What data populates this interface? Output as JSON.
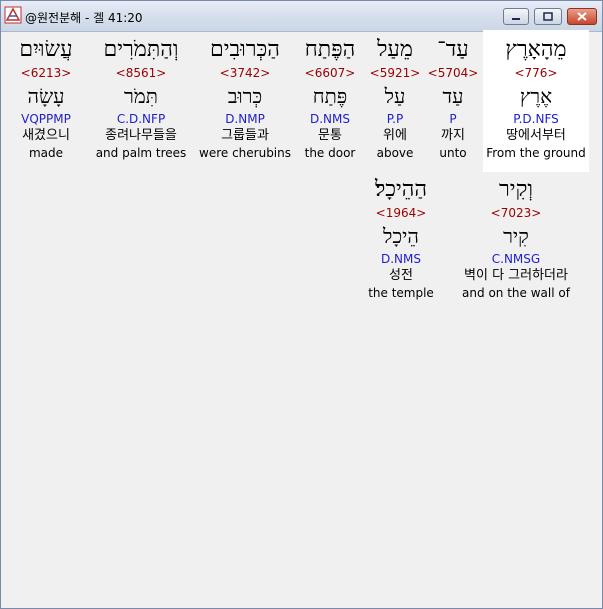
{
  "window": {
    "title": "@원전분해 - 겔 41:20"
  },
  "rows": [
    {
      "words": [
        {
          "hebrew": "עֲשׂוּיִם",
          "strong": "<6213>",
          "root": "עָשָׂה",
          "morph": "VQPPMP",
          "korean": "새겼으니",
          "english": "made",
          "highlight": false
        },
        {
          "hebrew": "וְהַתִּמֹרִים",
          "strong": "<8561>",
          "root": "תִּמֹר",
          "morph": "C.D.NFP",
          "korean": "종려나무들을",
          "english": "and palm trees",
          "highlight": false
        },
        {
          "hebrew": "הַכְּרוּבִים",
          "strong": "<3742>",
          "root": "כְּרוּב",
          "morph": "D.NMP",
          "korean": "그룹들과",
          "english": "were cherubins",
          "highlight": false
        },
        {
          "hebrew": "הַפֶּתַח",
          "strong": "<6607>",
          "root": "פֶּתַח",
          "morph": "D.NMS",
          "korean": "문통",
          "english": "the door",
          "highlight": false
        },
        {
          "hebrew": "מֵעַל",
          "strong": "<5921>",
          "root": "עַל",
          "morph": "P.P",
          "korean": "위에",
          "english": "above",
          "highlight": false
        },
        {
          "hebrew": "עַד־",
          "strong": "<5704>",
          "root": "עַד",
          "morph": "P",
          "korean": "까지",
          "english": "unto",
          "highlight": false
        },
        {
          "hebrew": "מֵהָאָרֶץ",
          "strong": "<776>",
          "root": "אֶרֶץ",
          "morph": "P.D.NFS",
          "korean": "땅에서부터",
          "english": "From the ground",
          "highlight": true
        }
      ]
    },
    {
      "words": [
        {
          "hebrew": "הַהֵיכָל׃",
          "strong": "<1964>",
          "root": "הֵיכָל",
          "morph": "D.NMS",
          "korean": "성전",
          "english": "the temple",
          "highlight": false
        },
        {
          "hebrew": "וְקִיר",
          "strong": "<7023>",
          "root": "קִיר",
          "morph": "C.NMSG",
          "korean": "벽이 다 그러하더라",
          "english": "and on the wall of",
          "highlight": false
        }
      ]
    }
  ]
}
